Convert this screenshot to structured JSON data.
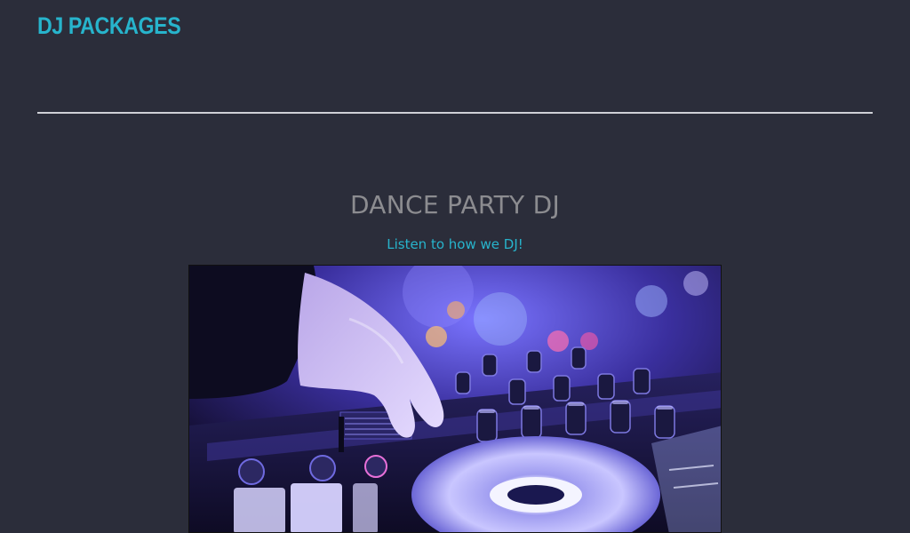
{
  "header": {
    "site_title": "DJ PACKAGES"
  },
  "main": {
    "headline": "DANCE PARTY DJ",
    "subheading_link": "Listen to how we DJ!"
  },
  "colors": {
    "background": "#2b2d3a",
    "accent": "#27b4cc",
    "headline": "#8c8c90",
    "divider": "#cfd0d6"
  }
}
